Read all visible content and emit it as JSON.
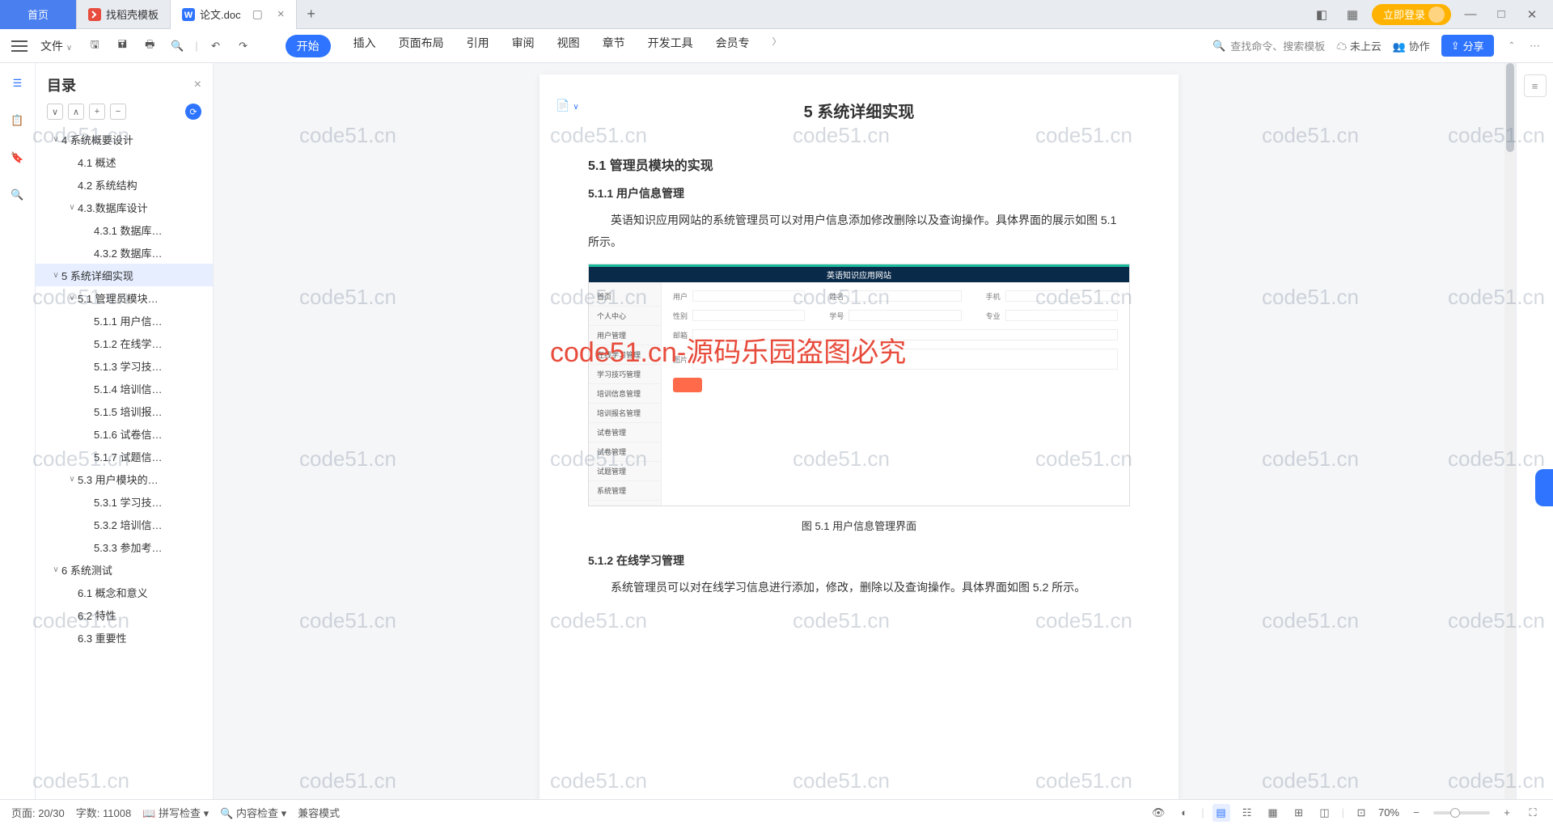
{
  "tabs": {
    "home": "首页",
    "template": "找稻壳模板",
    "doc": "论文.doc",
    "plus": "+"
  },
  "winctrl": {
    "login": "立即登录"
  },
  "ribbon": {
    "file": "文件",
    "tabs": [
      "开始",
      "插入",
      "页面布局",
      "引用",
      "审阅",
      "视图",
      "章节",
      "开发工具",
      "会员专"
    ],
    "search": "查找命令、搜索模板",
    "cloud": "未上云",
    "collab": "协作",
    "share": "分享"
  },
  "outline": {
    "title": "目录",
    "tree": [
      {
        "lvl": 0,
        "chev": "∨",
        "label": "4 系统概要设计"
      },
      {
        "lvl": 1,
        "chev": "",
        "label": "4.1 概述"
      },
      {
        "lvl": 1,
        "chev": "",
        "label": "4.2 系统结构"
      },
      {
        "lvl": 1,
        "chev": "∨",
        "label": "4.3.数据库设计"
      },
      {
        "lvl": 2,
        "chev": "",
        "label": "4.3.1 数据库…"
      },
      {
        "lvl": 2,
        "chev": "",
        "label": "4.3.2 数据库…"
      },
      {
        "lvl": 0,
        "chev": "∨",
        "label": "5 系统详细实现",
        "sel": true
      },
      {
        "lvl": 1,
        "chev": "∨",
        "label": "5.1 管理员模块…"
      },
      {
        "lvl": 2,
        "chev": "",
        "label": "5.1.1 用户信…"
      },
      {
        "lvl": 2,
        "chev": "",
        "label": "5.1.2 在线学…"
      },
      {
        "lvl": 2,
        "chev": "",
        "label": "5.1.3 学习技…"
      },
      {
        "lvl": 2,
        "chev": "",
        "label": "5.1.4 培训信…"
      },
      {
        "lvl": 2,
        "chev": "",
        "label": "5.1.5 培训报…"
      },
      {
        "lvl": 2,
        "chev": "",
        "label": "5.1.6 试卷信…"
      },
      {
        "lvl": 2,
        "chev": "",
        "label": "5.1.7 试题信…"
      },
      {
        "lvl": 1,
        "chev": "∨",
        "label": "5.3 用户模块的…"
      },
      {
        "lvl": 2,
        "chev": "",
        "label": "5.3.1 学习技…"
      },
      {
        "lvl": 2,
        "chev": "",
        "label": "5.3.2 培训信…"
      },
      {
        "lvl": 2,
        "chev": "",
        "label": "5.3.3 参加考…"
      },
      {
        "lvl": 0,
        "chev": "∨",
        "label": "6 系统测试"
      },
      {
        "lvl": 1,
        "chev": "",
        "label": "6.1 概念和意义"
      },
      {
        "lvl": 1,
        "chev": "",
        "label": "6.2 特性"
      },
      {
        "lvl": 1,
        "chev": "",
        "label": "6.3 重要性"
      }
    ]
  },
  "doc": {
    "h1": "5 系统详细实现",
    "h2_1": "5.1 管理员模块的实现",
    "h3_1": "5.1.1 用户信息管理",
    "p1": "英语知识应用网站的系统管理员可以对用户信息添加修改删除以及查询操作。具体界面的展示如图 5.1 所示。",
    "cap1": "图 5.1 用户信息管理界面",
    "h3_2": "5.1.2 在线学习管理",
    "p2": "系统管理员可以对在线学习信息进行添加，修改，删除以及查询操作。具体界面如图 5.2 所示。",
    "fig_title": "英语知识应用网站",
    "fig_side": [
      "首页",
      "个人中心",
      "用户管理",
      "在线学习管理",
      "学习技巧管理",
      "培训信息管理",
      "培训报名管理",
      "试卷管理",
      "试卷管理",
      "试题管理",
      "系统管理"
    ]
  },
  "status": {
    "page": "页面: 20/30",
    "words": "字数: 11008",
    "spell": "拼写检查",
    "content": "内容检查",
    "compat": "兼容模式",
    "zoom": "70%"
  },
  "watermark": "code51.cn",
  "watermark_red": "code51.cn-源码乐园盗图必究"
}
